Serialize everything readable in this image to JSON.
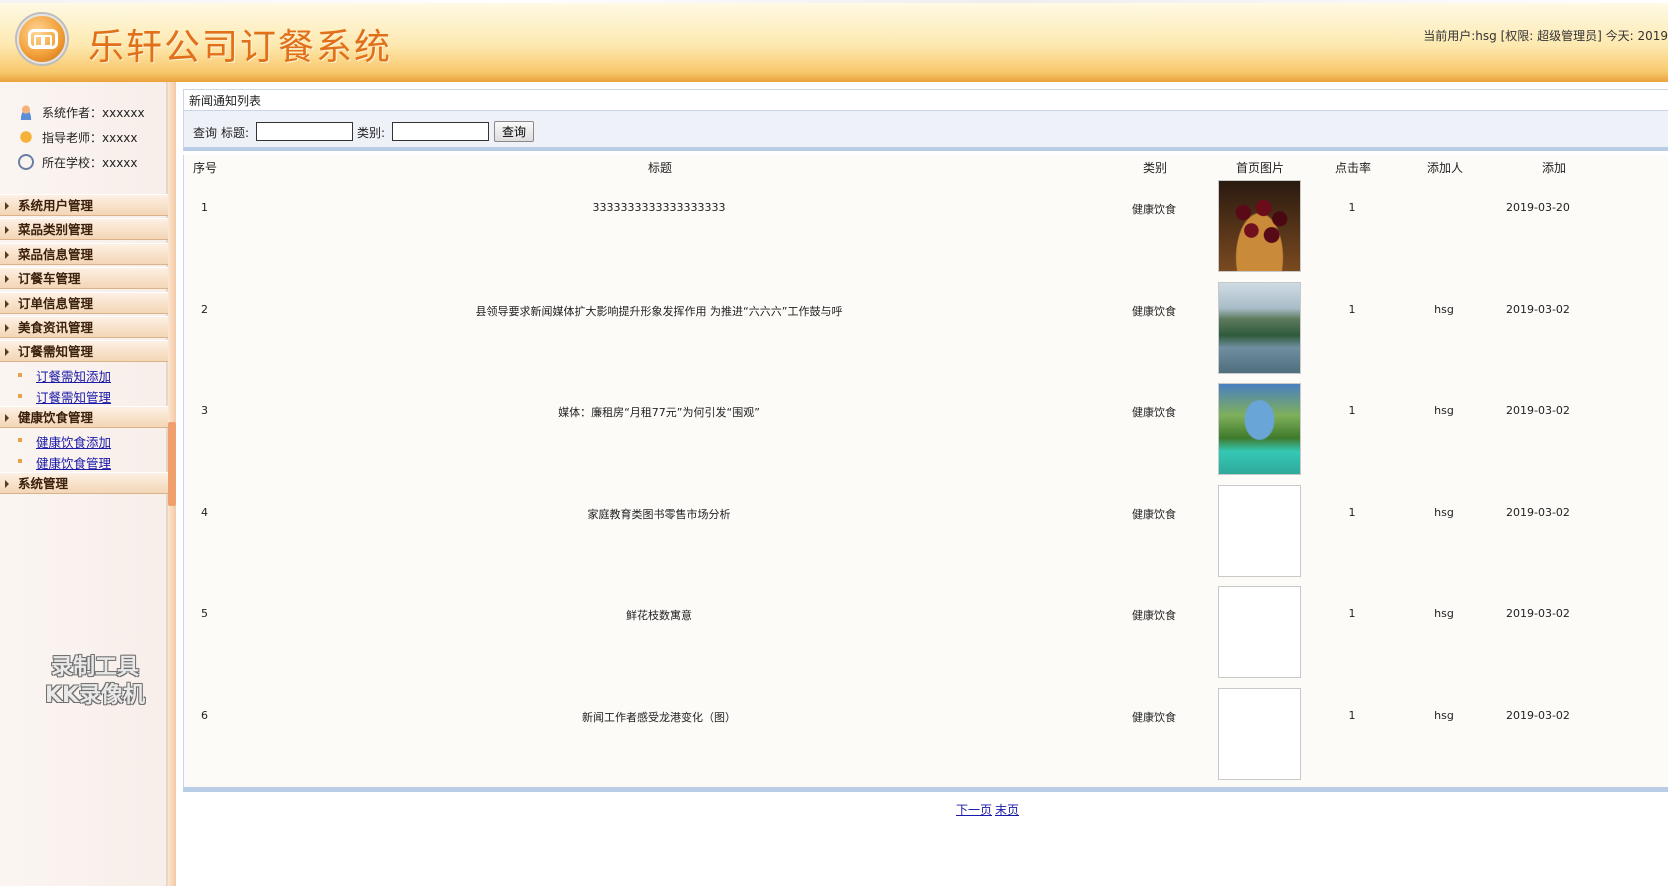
{
  "header": {
    "title": "乐轩公司订餐系统",
    "user_info": "当前用户:hsg [权限: 超级管理员] 今天:  2019"
  },
  "sidebar": {
    "info": [
      {
        "icon": "user-icon",
        "label": "系统作者：xxxxxx"
      },
      {
        "icon": "teacher-icon",
        "label": "指导老师：xxxxx"
      },
      {
        "icon": "school-icon",
        "label": "所在学校：xxxxx"
      }
    ],
    "menu": [
      "系统用户管理",
      "菜品类别管理",
      "菜品信息管理",
      "订餐车管理",
      "订单信息管理",
      "美食资讯管理",
      "订餐需知管理",
      "健康饮食管理",
      "系统管理"
    ],
    "submenu_notice": [
      "订餐需知添加",
      "订餐需知管理"
    ],
    "submenu_health": [
      "健康饮食添加",
      "健康饮食管理"
    ],
    "watermark": [
      "录制工具",
      "KK录像机"
    ]
  },
  "main": {
    "panel_title": "新闻通知列表",
    "search": {
      "query_label": "查询",
      "title_label": "标题:",
      "category_label": "类别:",
      "title_value": "",
      "category_value": "",
      "button": "查询"
    },
    "columns": [
      "序号",
      "标题",
      "类别",
      "首页图片",
      "点击率",
      "添加人",
      "添加"
    ],
    "rows": [
      {
        "no": "1",
        "title": "3333333333333333333",
        "category": "健康饮食",
        "image": "cherry",
        "clicks": "1",
        "adder": "",
        "date": "2019-03-20"
      },
      {
        "no": "2",
        "title": "县领导要求新闻媒体扩大影响提升形象发挥作用 为推进“六六六”工作鼓与呼",
        "category": "健康饮食",
        "image": "river",
        "clicks": "1",
        "adder": "hsg",
        "date": "2019-03-02"
      },
      {
        "no": "3",
        "title": "媒体：廉租房“月租77元”为何引发“围观”",
        "category": "健康饮食",
        "image": "lake",
        "clicks": "1",
        "adder": "hsg",
        "date": "2019-03-02"
      },
      {
        "no": "4",
        "title": "家庭教育类图书零售市场分析",
        "category": "健康饮食",
        "image": "",
        "clicks": "1",
        "adder": "hsg",
        "date": "2019-03-02"
      },
      {
        "no": "5",
        "title": "鲜花枝数寓意",
        "category": "健康饮食",
        "image": "",
        "clicks": "1",
        "adder": "hsg",
        "date": "2019-03-02"
      },
      {
        "no": "6",
        "title": "新闻工作者感受龙港变化（图）",
        "category": "健康饮食",
        "image": "",
        "clicks": "1",
        "adder": "hsg",
        "date": "2019-03-02"
      }
    ],
    "pager": {
      "next": "下一页",
      "last": "末页"
    }
  }
}
